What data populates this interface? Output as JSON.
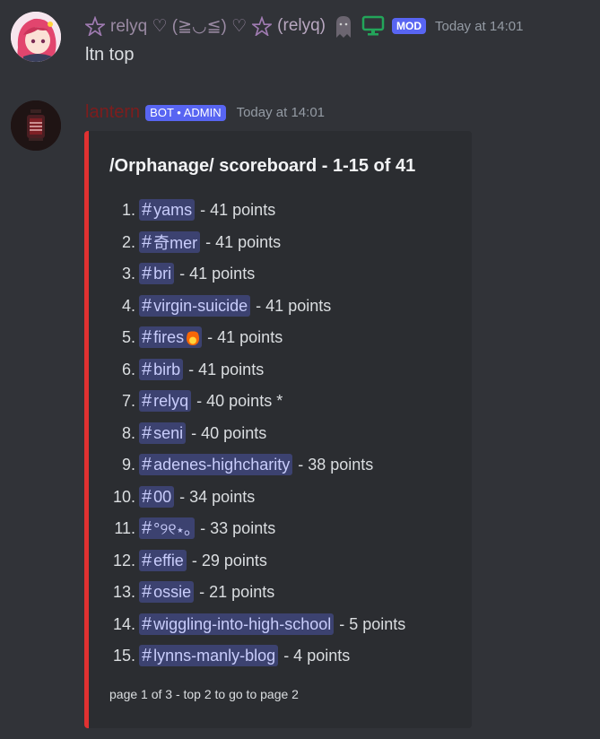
{
  "message1": {
    "author_name": "relyq ♡ (≧◡≦) ♡",
    "author_handle": "(relyq)",
    "role_badge": "MOD",
    "timestamp": "Today at 14:01",
    "content": "ltn top"
  },
  "message2": {
    "author_name": "lantern",
    "bot_badge": "BOT • ADMIN",
    "timestamp": "Today at 14:01",
    "embed": {
      "accent_color": "#e03131",
      "title": "/Orphanage/ scoreboard - 1-15 of 41",
      "rows": [
        {
          "rank": "1.",
          "channel": "yams",
          "points": "- 41 points"
        },
        {
          "rank": "2.",
          "channel": "奇mer",
          "points": "- 41 points"
        },
        {
          "rank": "3.",
          "channel": "bri",
          "points": "- 41 points"
        },
        {
          "rank": "4.",
          "channel": "virgin-suicide",
          "points": "- 41 points"
        },
        {
          "rank": "5.",
          "channel": "fires",
          "points": "- 41 points",
          "icon": "fire-icon"
        },
        {
          "rank": "6.",
          "channel": "birb",
          "points": "- 41 points"
        },
        {
          "rank": "7.",
          "channel": "relyq",
          "points": "- 40 points *"
        },
        {
          "rank": "8.",
          "channel": "seni",
          "points": "- 40 points"
        },
        {
          "rank": "9.",
          "channel": "adenes-highcharity",
          "points": "- 38 points"
        },
        {
          "rank": "10.",
          "channel": "00",
          "points": "- 34 points"
        },
        {
          "rank": "11.",
          "channel": "°୨୧⋆｡",
          "points": "- 33 points"
        },
        {
          "rank": "12.",
          "channel": "effie",
          "points": "- 29 points"
        },
        {
          "rank": "13.",
          "channel": "ossie",
          "points": "- 21 points"
        },
        {
          "rank": "14.",
          "channel": "wiggling-into-high-school",
          "points": "- 5 points"
        },
        {
          "rank": "15.",
          "channel": "lynns-manly-blog",
          "points": "- 4 points"
        }
      ],
      "footer": "page 1 of 3 - top 2 to go to page 2"
    }
  },
  "icons": [
    "pentagram-icon",
    "ghost-icon",
    "desktop-icon",
    "fire-icon",
    "hash-icon"
  ],
  "colors": {
    "background": "#313338",
    "embed_bg": "#2b2d31",
    "mod_badge": "#5865f2",
    "online_green": "#23a55a"
  }
}
